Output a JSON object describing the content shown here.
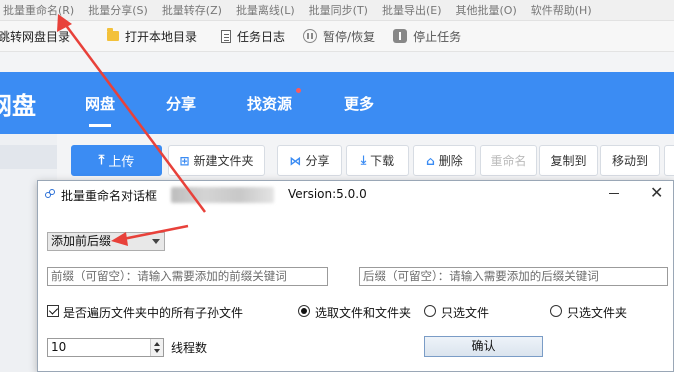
{
  "menu": [
    "批量重命名(R)",
    "批量分享(S)",
    "批量转存(Z)",
    "批量离线(L)",
    "批量同步(T)",
    "批量导出(E)",
    "其他批量(O)",
    "软件帮助(H)"
  ],
  "toolbar": {
    "item1": "跳转网盘目录",
    "item2": "打开本地目录",
    "item3": "任务日志",
    "item4": "暂停/恢复",
    "item5": "停止任务"
  },
  "header": {
    "brand": "网盘",
    "tabs": [
      "网盘",
      "分享",
      "找资源",
      "更多"
    ]
  },
  "actions": {
    "upload": "上传",
    "new_folder": "新建文件夹",
    "share": "分享",
    "download": "下载",
    "delete": "删除",
    "rename": "重命名",
    "copy_to": "复制到",
    "move_to": "移动到"
  },
  "dialog": {
    "title": "批量重命名对话框",
    "version": "Version:5.0.0",
    "mode_selected": "添加前后缀",
    "prefix_placeholder": "前缀（可留空）：请输入需要添加的前缀关键词",
    "suffix_placeholder": "后缀（可留空）：请输入需要添加的后缀关键词",
    "traverse_label": "是否遍历文件夹中的所有子孙文件",
    "traverse_checked": true,
    "radio_both": "选取文件和文件夹",
    "radio_files": "只选文件",
    "radio_folders": "只选文件夹",
    "radio_selected": "both",
    "threads_value": "10",
    "threads_label": "线程数",
    "confirm": "确认"
  },
  "colors": {
    "brand_blue": "#3b8cf3",
    "annotation_red": "#e8413a"
  }
}
